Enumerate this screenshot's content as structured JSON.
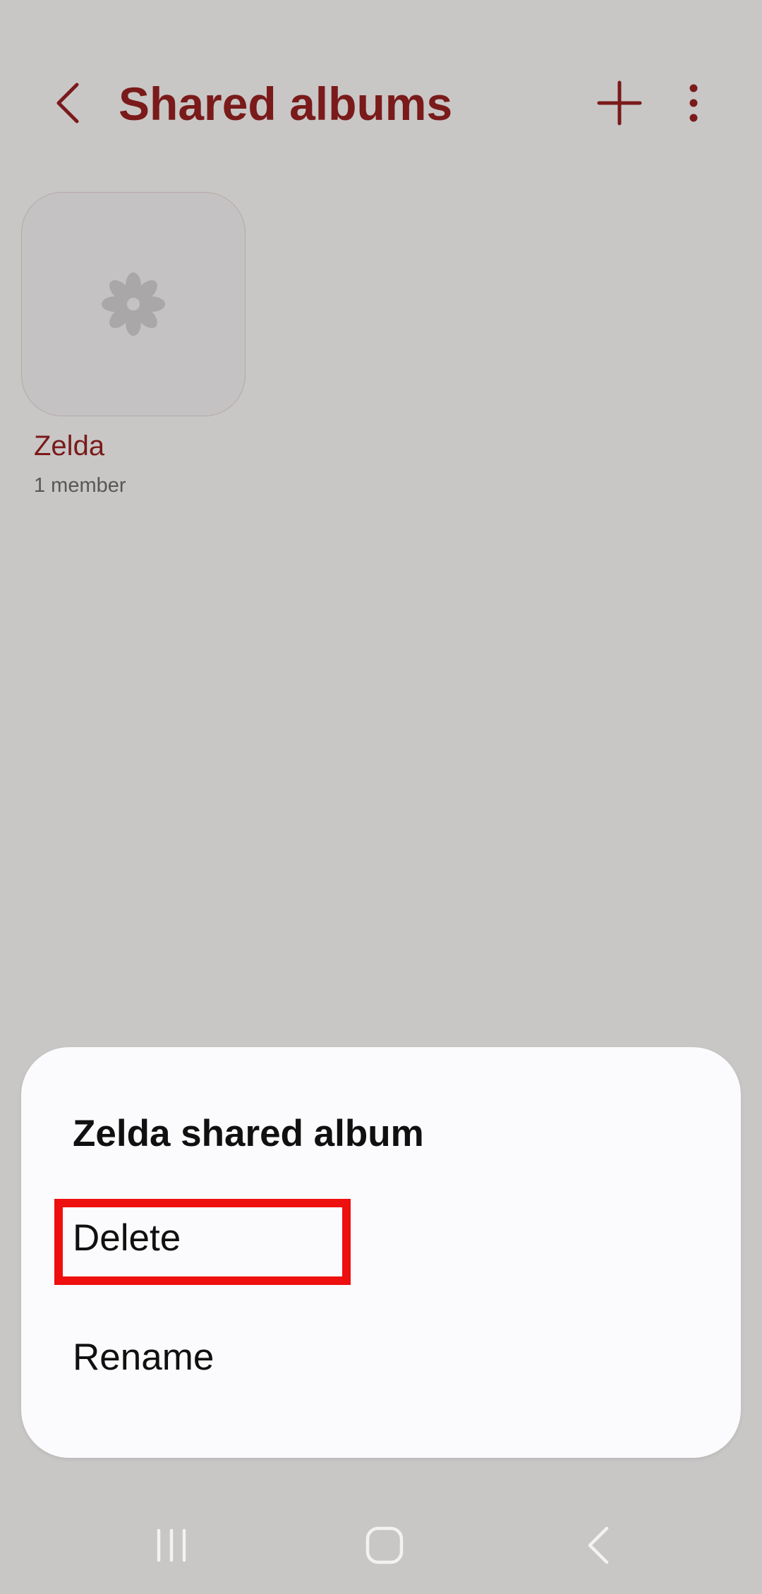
{
  "header": {
    "title": "Shared albums",
    "back_icon": "chevron-left-icon",
    "add_icon": "plus-icon",
    "more_icon": "more-vertical-icon"
  },
  "albums": [
    {
      "name": "Zelda",
      "members": "1 member",
      "thumbnail_icon": "flower-placeholder-icon"
    }
  ],
  "sheet": {
    "title": "Zelda shared album",
    "items": [
      {
        "label": "Delete",
        "highlighted": true
      },
      {
        "label": "Rename",
        "highlighted": false
      }
    ]
  },
  "navbar": {
    "recent_icon": "recent-apps-icon",
    "home_icon": "home-icon",
    "back_icon": "back-icon"
  },
  "colors": {
    "accent": "#7a1a1a",
    "background": "#c8c7c6",
    "sheet_background": "#fbfbfd",
    "highlight": "#ee0f0f"
  }
}
